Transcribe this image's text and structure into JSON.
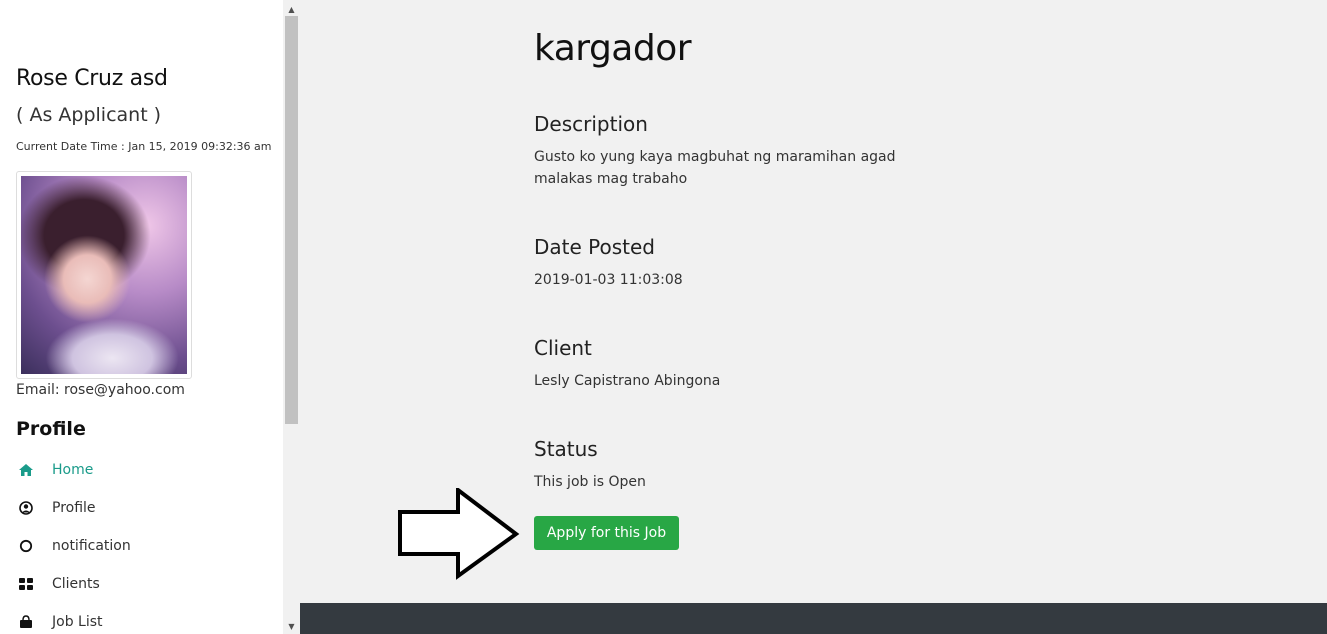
{
  "sidebar": {
    "user_name": "Rose Cruz asd",
    "user_role": "( As Applicant )",
    "current_time": "Current Date Time : Jan 15, 2019 09:32:36 am",
    "email": "Email: rose@yahoo.com",
    "section_title": "Profile",
    "nav": [
      {
        "label": "Home",
        "icon": "home-icon",
        "active": true
      },
      {
        "label": "Profile",
        "icon": "user-circle-icon",
        "active": false
      },
      {
        "label": "notification",
        "icon": "circle-icon",
        "active": false
      },
      {
        "label": "Clients",
        "icon": "grid-icon",
        "active": false
      },
      {
        "label": "Job List",
        "icon": "shopping-bag-icon",
        "active": false
      }
    ]
  },
  "job": {
    "title": "kargador",
    "description_label": "Description",
    "description": "Gusto ko yung kaya magbuhat ng maramihan agad malakas mag trabaho",
    "date_posted_label": "Date Posted",
    "date_posted": "2019-01-03 11:03:08",
    "client_label": "Client",
    "client": "Lesly Capistrano Abingona",
    "status_label": "Status",
    "status": "This job is Open",
    "apply_label": "Apply for this Job"
  },
  "colors": {
    "accent": "#1a9b8a",
    "apply_button": "#28a745",
    "footer": "#343a40"
  }
}
